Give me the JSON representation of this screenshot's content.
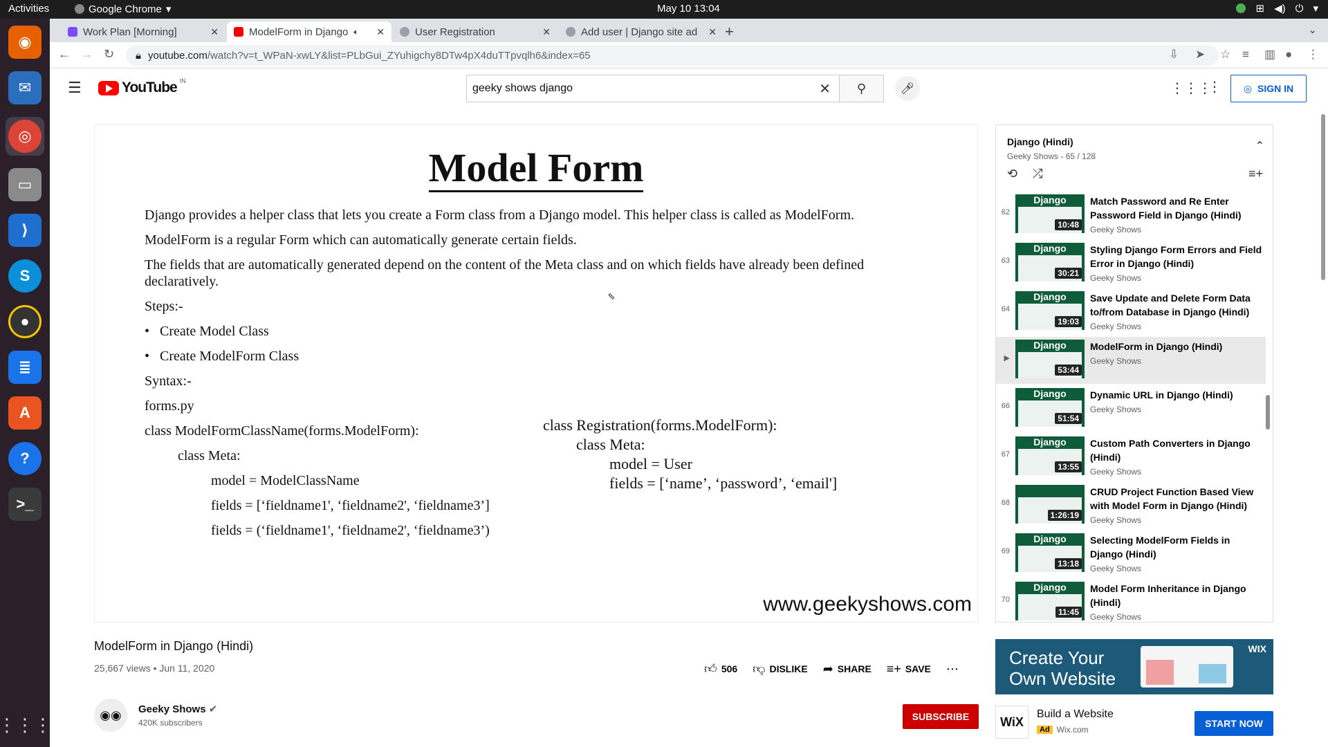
{
  "topbar": {
    "activities": "Activities",
    "app": "Google Chrome",
    "clock": "May 10  13:04"
  },
  "tabs": [
    {
      "label": "Work Plan [Morning]",
      "color": "#7c4dff"
    },
    {
      "label": "ModelForm in Django",
      "color": "#ff0000"
    },
    {
      "label": "User Registration",
      "color": "#9aa0a6"
    },
    {
      "label": "Add user | Django site ad",
      "color": "#9aa0a6"
    }
  ],
  "address": {
    "host": "youtube.com",
    "path": "/watch?v=t_WPaN-xwLY&list=PLbGui_ZYuhigchy8DTw4pX4duTTpvqlh6&index=65"
  },
  "yt": {
    "logo": "YouTube",
    "country": "IN",
    "search_value": "geeky shows django",
    "signin": "SIGN IN"
  },
  "slide": {
    "title": "Model Form",
    "p1": "Django provides a helper class that lets you create a Form class from a Django model. This helper class is called as ModelForm.",
    "p2": "ModelForm is a regular Form which can automatically generate certain fields.",
    "p3": "The fields that are automatically generated depend on the content of the Meta class and on which fields have already been defined",
    "p3b": "declaratively.",
    "steps": "Steps:-",
    "b1": "Create Model Class",
    "b2": "Create ModelForm Class",
    "syntax": "Syntax:-",
    "file": "forms.py",
    "c1": "class ModelFormClassName(forms.ModelForm):",
    "c2": "class Meta:",
    "c3": "model = ModelClassName",
    "c4": "fields = [‘fieldname1', ‘fieldname2', ‘fieldname3’]",
    "c5": "fields = (‘fieldname1', ‘fieldname2', ‘fieldname3’)",
    "r1": "class Registration(forms.ModelForm):",
    "r2": "class Meta:",
    "r3": "model = User",
    "r4": "fields = [‘name’, ‘password’, ‘email']",
    "watermark": "www.geekyshows.com"
  },
  "video": {
    "title": "ModelForm in Django (Hindi)",
    "meta": "25,667 views • Jun 11, 2020",
    "likes": "506",
    "dislike": "DISLIKE",
    "share": "SHARE",
    "save": "SAVE"
  },
  "channel": {
    "name": "Geeky Shows",
    "subs": "420K subscribers",
    "subscribe": "SUBSCRIBE"
  },
  "playlist": {
    "title": "Django (Hindi)",
    "owner": "Geeky Shows",
    "position": "65 / 128",
    "items": [
      {
        "idx": "62",
        "title": "Match Password and Re Enter Password Field in Django (Hindi)",
        "channel": "Geeky Shows",
        "dur": "10:48",
        "thumb": "Django"
      },
      {
        "idx": "63",
        "title": "Styling Django Form Errors and Field Error in Django (Hindi)",
        "channel": "Geeky Shows",
        "dur": "30:21",
        "thumb": "Django"
      },
      {
        "idx": "64",
        "title": "Save Update and Delete Form Data to/from Database in Django (Hindi)",
        "channel": "Geeky Shows",
        "dur": "19:03",
        "thumb": "Django"
      },
      {
        "idx": "▶",
        "title": "ModelForm in Django (Hindi)",
        "channel": "Geeky Shows",
        "dur": "53:44",
        "thumb": "Django"
      },
      {
        "idx": "66",
        "title": "Dynamic URL in Django (Hindi)",
        "channel": "Geeky Shows",
        "dur": "51:54",
        "thumb": "Django"
      },
      {
        "idx": "67",
        "title": "Custom Path Converters in Django (Hindi)",
        "channel": "Geeky Shows",
        "dur": "13:55",
        "thumb": "Django"
      },
      {
        "idx": "68",
        "title": "CRUD Project Function Based View with Model Form in Django (Hindi)",
        "channel": "Geeky Shows",
        "dur": "1:26:19",
        "thumb": ""
      },
      {
        "idx": "69",
        "title": "Selecting ModelForm Fields in Django (Hindi)",
        "channel": "Geeky Shows",
        "dur": "13:18",
        "thumb": "Django"
      },
      {
        "idx": "70",
        "title": "Model Form Inheritance in Django (Hindi)",
        "channel": "Geeky Shows",
        "dur": "11:45",
        "thumb": "Django"
      }
    ]
  },
  "ad": {
    "line1": "Create Your",
    "line2": "Own Website",
    "brand": "WIX",
    "logo": "WiX",
    "title": "Build a Website",
    "badge": "Ad",
    "domain": "Wix.com",
    "cta": "START NOW"
  }
}
